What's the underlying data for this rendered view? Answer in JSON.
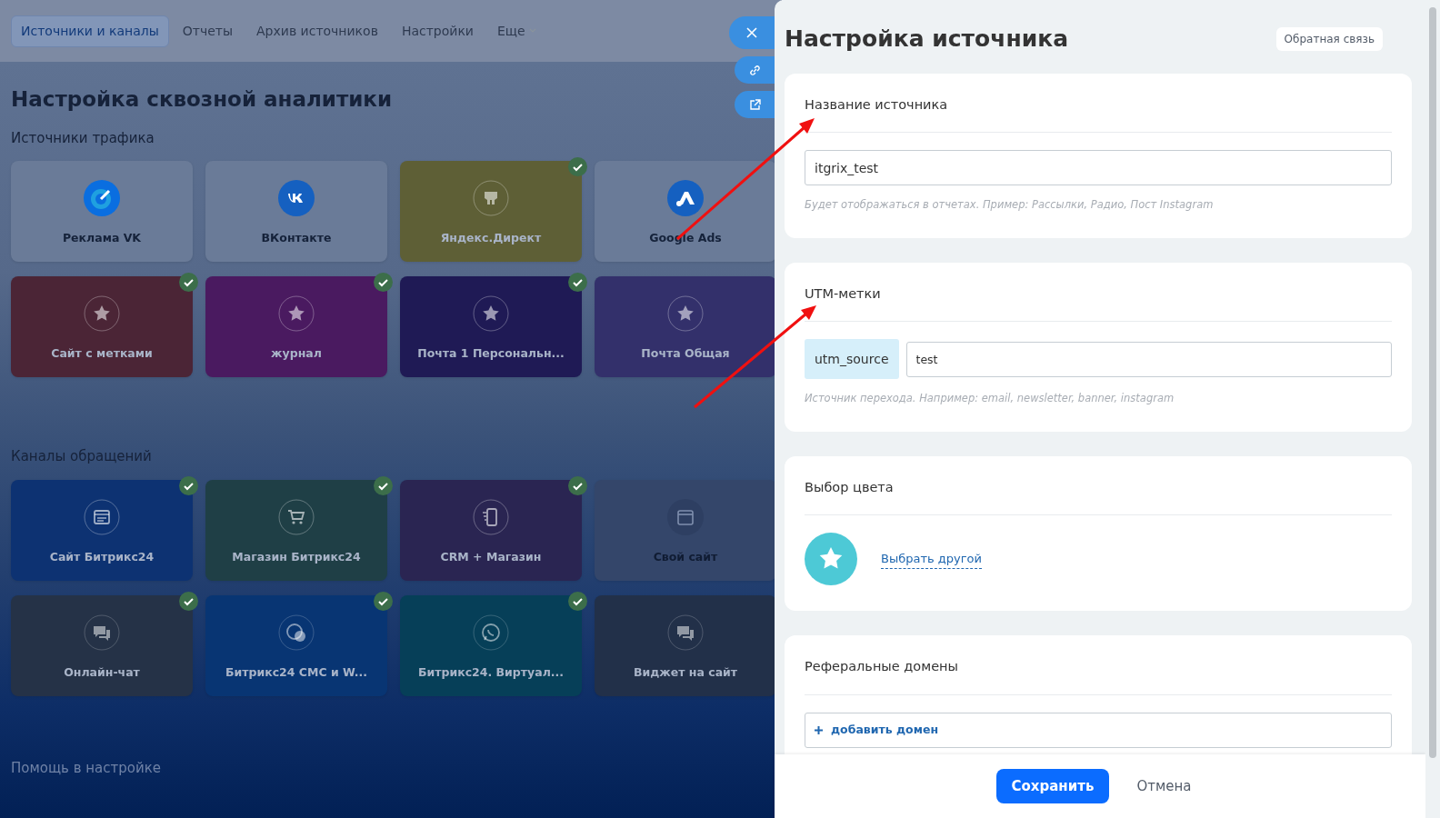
{
  "nav": {
    "tabs": [
      {
        "label": "Источники и каналы",
        "selected": true,
        "kind": "link"
      },
      {
        "label": "Отчеты",
        "selected": false,
        "kind": "link"
      },
      {
        "label": "Архив источников",
        "selected": false,
        "kind": "link"
      },
      {
        "label": "Настройки",
        "selected": false,
        "kind": "link"
      },
      {
        "label": "Еще",
        "selected": false,
        "kind": "dropdown"
      }
    ]
  },
  "page": {
    "title": "Настройка сквозной аналитики",
    "sections": [
      {
        "title": "Источники трафика",
        "cards": [
          {
            "name": "Реклама VK",
            "color": "#6a7b98",
            "checked": false
          },
          {
            "name": "ВКонтакте",
            "color": "#6a7b98",
            "checked": false
          },
          {
            "name": "Яндекс.Директ",
            "color": "#5e5f36",
            "checked": true
          },
          {
            "name": "Google Ads",
            "color": "#6a7b98",
            "checked": false
          },
          {
            "name": "Сайт с метками",
            "color": "#4b2536",
            "checked": true
          },
          {
            "name": "журнал",
            "color": "#4a1a60",
            "checked": true
          },
          {
            "name": "Почта 1 Персональн...",
            "color": "#1f1a55",
            "checked": true
          },
          {
            "name": "Почта Общая",
            "color": "#33306b",
            "checked": false
          }
        ]
      },
      {
        "title": "Каналы обращений",
        "cards": [
          {
            "name": "Сайт Битрикс24",
            "color": "#0d3272",
            "checked": true
          },
          {
            "name": "Магазин Битрикс24",
            "color": "#1f3f46",
            "checked": true
          },
          {
            "name": "CRM + Магазин",
            "color": "#2a2552",
            "checked": true
          },
          {
            "name": "Свой сайт",
            "color": "#34466a",
            "checked": false
          },
          {
            "name": "Онлайн-чат",
            "color": "#253247",
            "checked": true
          },
          {
            "name": "Битрикс24 СМС и W...",
            "color": "#083573",
            "checked": true
          },
          {
            "name": "Битрикс24. Виртуал...",
            "color": "#063f58",
            "checked": true
          },
          {
            "name": "Виджет на сайт",
            "color": "#223049",
            "checked": false
          }
        ]
      }
    ],
    "help_title": "Помощь в настройке"
  },
  "panel": {
    "title": "Настройка источника",
    "feedback_button": "Обратная связь",
    "sections": [
      {
        "kind": "text",
        "title": "Название источника",
        "value": "itgrix_test",
        "hint": "Будет отображаться в отчетах. Пример: Рассылки, Радио, Пост Instagram"
      },
      {
        "kind": "utm",
        "title": "UTM-метки",
        "tag": "utm_source",
        "value": "test",
        "hint": "Источник перехода. Например: email, newsletter, banner, instagram"
      },
      {
        "kind": "color",
        "title": "Выбор цвета",
        "color": "#4dc9d6",
        "link": "Выбрать другой"
      },
      {
        "kind": "domains",
        "title": "Реферальные домены",
        "add_button": "добавить домен"
      }
    ],
    "footer": {
      "save": "Сохранить",
      "cancel": "Отмена"
    }
  }
}
